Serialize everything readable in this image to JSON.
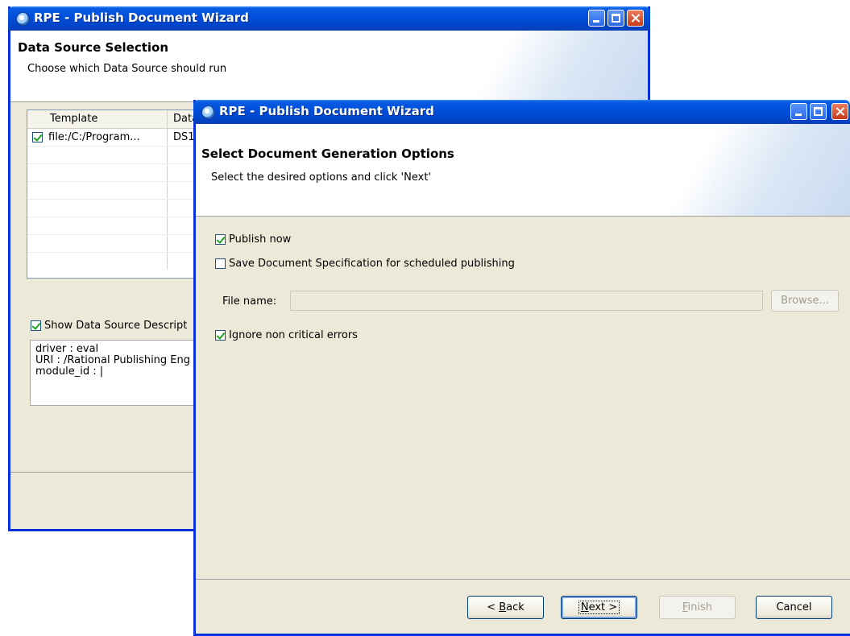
{
  "back_window": {
    "title": "RPE - Publish Document Wizard",
    "header_title": "Data Source Selection",
    "header_subtitle": "Choose which Data Source should run",
    "table": {
      "columns": [
        "Template",
        "Data"
      ],
      "rows": [
        {
          "checked": true,
          "template": "file:/C:/Program...",
          "data": "DS1"
        }
      ]
    },
    "show_description_label": "Show Data Source Descript",
    "description_lines": [
      "driver : eval",
      "URI : /Rational Publishing Eng",
      "module_id : |"
    ]
  },
  "front_window": {
    "title": "RPE - Publish Document Wizard",
    "header_title": "Select Document Generation Options",
    "header_subtitle": "Select the desired options and click 'Next'",
    "options": {
      "publish_now": {
        "label": "Publish now",
        "checked": true
      },
      "save_spec": {
        "label": "Save Document Specification for scheduled publishing",
        "checked": false
      },
      "ignore_errors": {
        "label": "Ignore non critical errors",
        "checked": true
      }
    },
    "file_name_label": "File name:",
    "file_name_value": "",
    "browse_label": "Browse...",
    "buttons": {
      "back": {
        "prefix": "< ",
        "mnemonic": "B",
        "rest": "ack"
      },
      "next": {
        "mnemonic": "N",
        "rest": "ext >"
      },
      "finish": {
        "mnemonic": "F",
        "rest": "inish"
      },
      "cancel": "Cancel"
    }
  },
  "colors": {
    "titlebar": "#0050dd",
    "window_border": "#0831d9",
    "dialog_bg": "#ece9d8",
    "checkmark": "#21a121"
  }
}
